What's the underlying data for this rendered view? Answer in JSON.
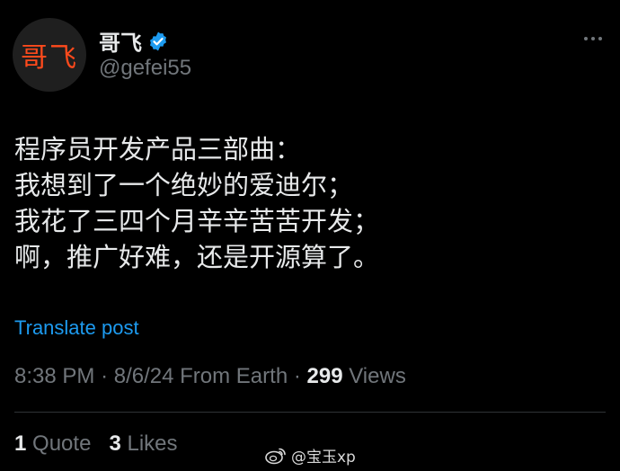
{
  "author": {
    "avatar_text": "哥飞",
    "display_name": "哥飞",
    "handle": "@gefei55",
    "verified_icon": "verified-badge-icon"
  },
  "more_icon": "more-icon",
  "post": {
    "lines": [
      "程序员开发产品三部曲：",
      "我想到了一个绝妙的爱迪尔；",
      "我花了三四个月辛辛苦苦开发；",
      "啊，推广好难，还是开源算了。"
    ]
  },
  "translate_label": "Translate post",
  "meta": {
    "time": "8:38 PM",
    "date": "8/6/24",
    "source": "From Earth",
    "views_count": "299",
    "views_label": "Views"
  },
  "stats": {
    "quotes_count": "1",
    "quotes_label": "Quote",
    "likes_count": "3",
    "likes_label": "Likes"
  },
  "watermark": {
    "text": "@宝玉xp",
    "icon": "weibo-icon"
  },
  "colors": {
    "background": "#000000",
    "text": "#e7e9ea",
    "muted": "#71767b",
    "link": "#1d9bf0",
    "avatar_text": "#ff4a1c"
  }
}
